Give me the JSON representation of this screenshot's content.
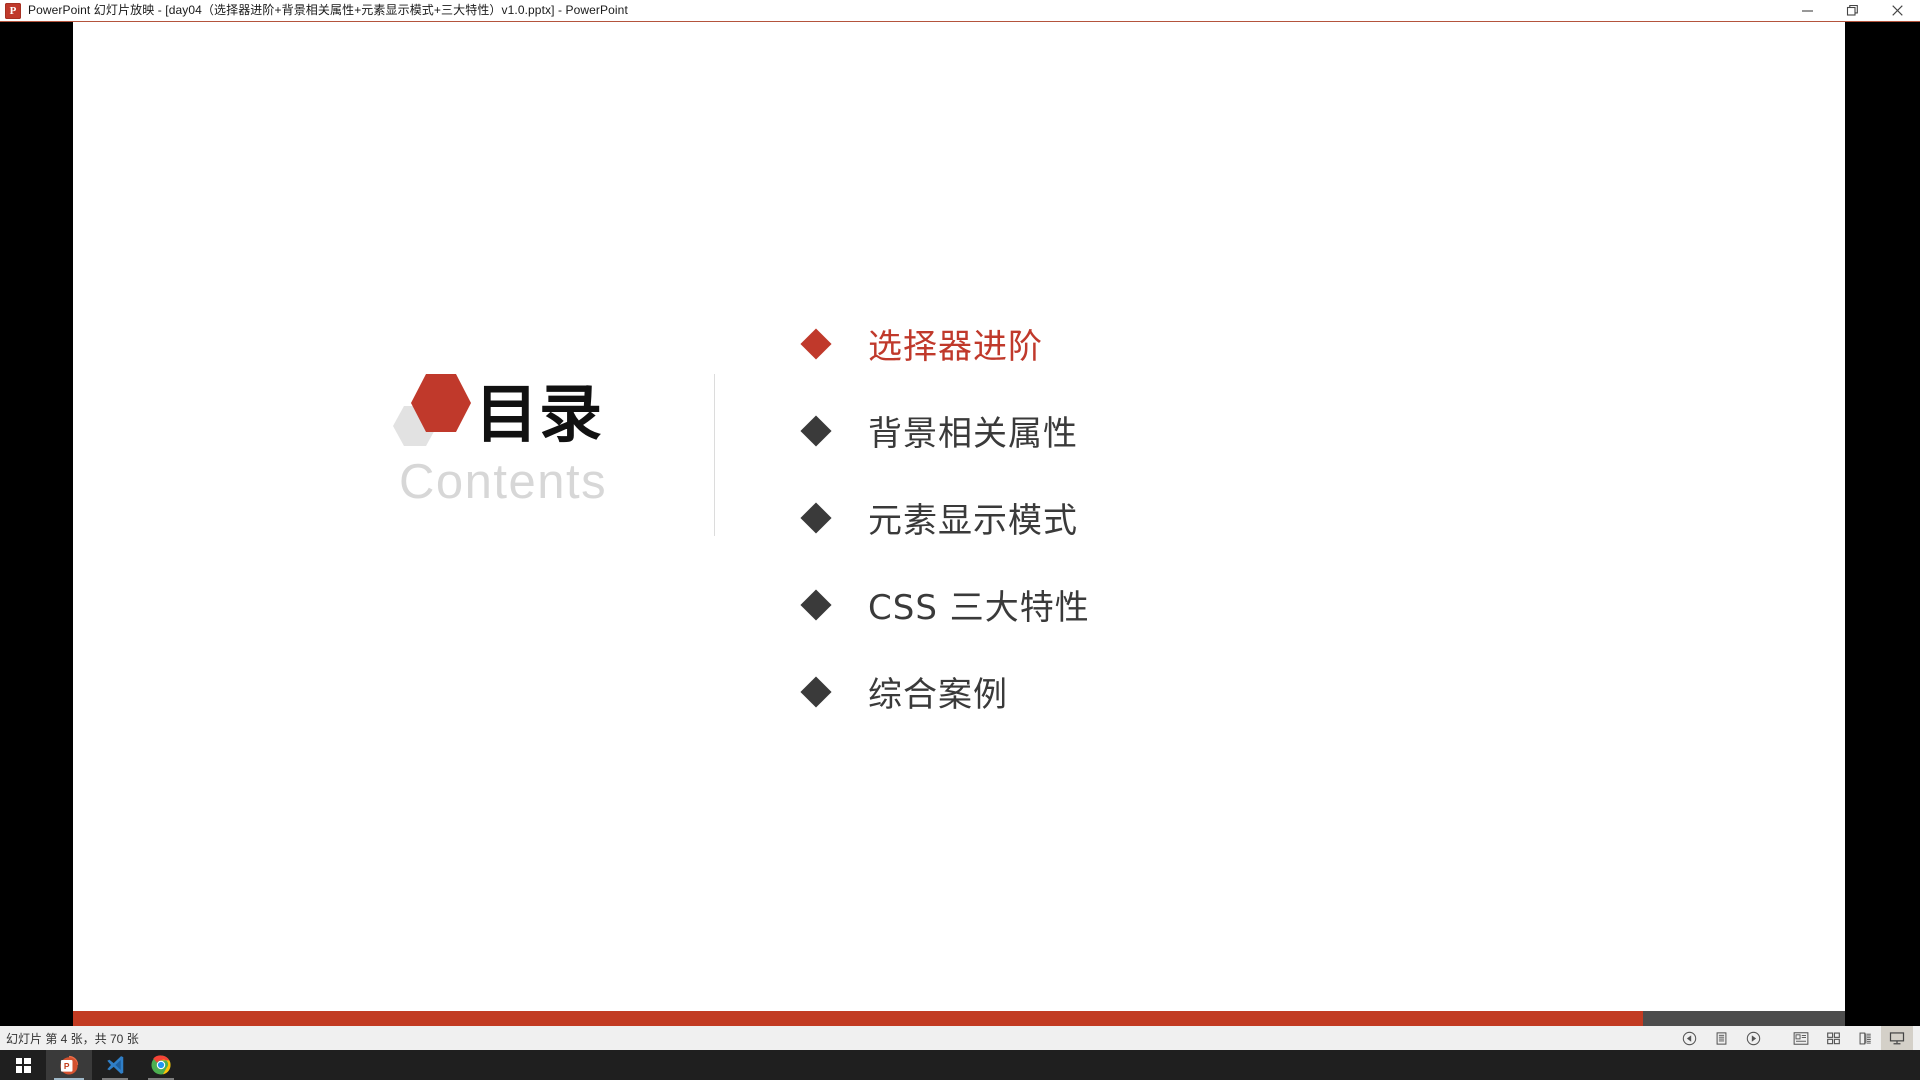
{
  "window": {
    "app_icon": "powerpoint-icon",
    "title": "PowerPoint 幻灯片放映 - [day04（选择器进阶+背景相关属性+元素显示模式+三大特性）v1.0.pptx] - PowerPoint",
    "controls": [
      {
        "name": "minimize-button",
        "icon": "minimize-icon"
      },
      {
        "name": "restore-button",
        "icon": "restore-icon"
      },
      {
        "name": "close-button",
        "icon": "close-icon"
      }
    ]
  },
  "slide": {
    "title_cn": "目录",
    "title_en": "Contents",
    "logo": {
      "name": "hexagon-logo",
      "primary_color": "#c0392b",
      "secondary_color": "#e0e0e0"
    },
    "items": [
      {
        "label": "选择器进阶",
        "active": true
      },
      {
        "label": "背景相关属性",
        "active": false
      },
      {
        "label": "元素显示模式",
        "active": false
      },
      {
        "label": "CSS 三大特性",
        "active": false
      },
      {
        "label": "综合案例",
        "active": false
      }
    ],
    "accent_color": "#c0392b",
    "text_color": "#3a3a3a"
  },
  "progress": {
    "percent": 88.6,
    "fill_color": "#c23b22",
    "track_color": "#4d4d4d"
  },
  "statusbar": {
    "text": "幻灯片 第 4 张，共 70 张",
    "current_slide": 4,
    "total_slides": 70,
    "view_buttons": [
      {
        "name": "previous-slide-button",
        "icon": "previous-icon",
        "active": false
      },
      {
        "name": "notes-button",
        "icon": "notes-icon",
        "active": false
      },
      {
        "name": "next-slide-button",
        "icon": "next-icon",
        "active": false
      },
      {
        "name": "normal-view-button",
        "icon": "normal-view-icon",
        "active": false
      },
      {
        "name": "slide-sorter-button",
        "icon": "slide-sorter-icon",
        "active": false
      },
      {
        "name": "reading-view-button",
        "icon": "reading-view-icon",
        "active": false
      },
      {
        "name": "slideshow-button",
        "icon": "slideshow-icon",
        "active": true
      }
    ]
  },
  "taskbar": {
    "start": {
      "name": "start-button",
      "icon": "windows-logo-icon"
    },
    "apps": [
      {
        "name": "taskbar-powerpoint",
        "icon": "powerpoint-icon",
        "state": "running"
      },
      {
        "name": "taskbar-vscode",
        "icon": "vscode-icon",
        "state": "open"
      },
      {
        "name": "taskbar-chrome",
        "icon": "chrome-icon",
        "state": "open"
      }
    ]
  }
}
